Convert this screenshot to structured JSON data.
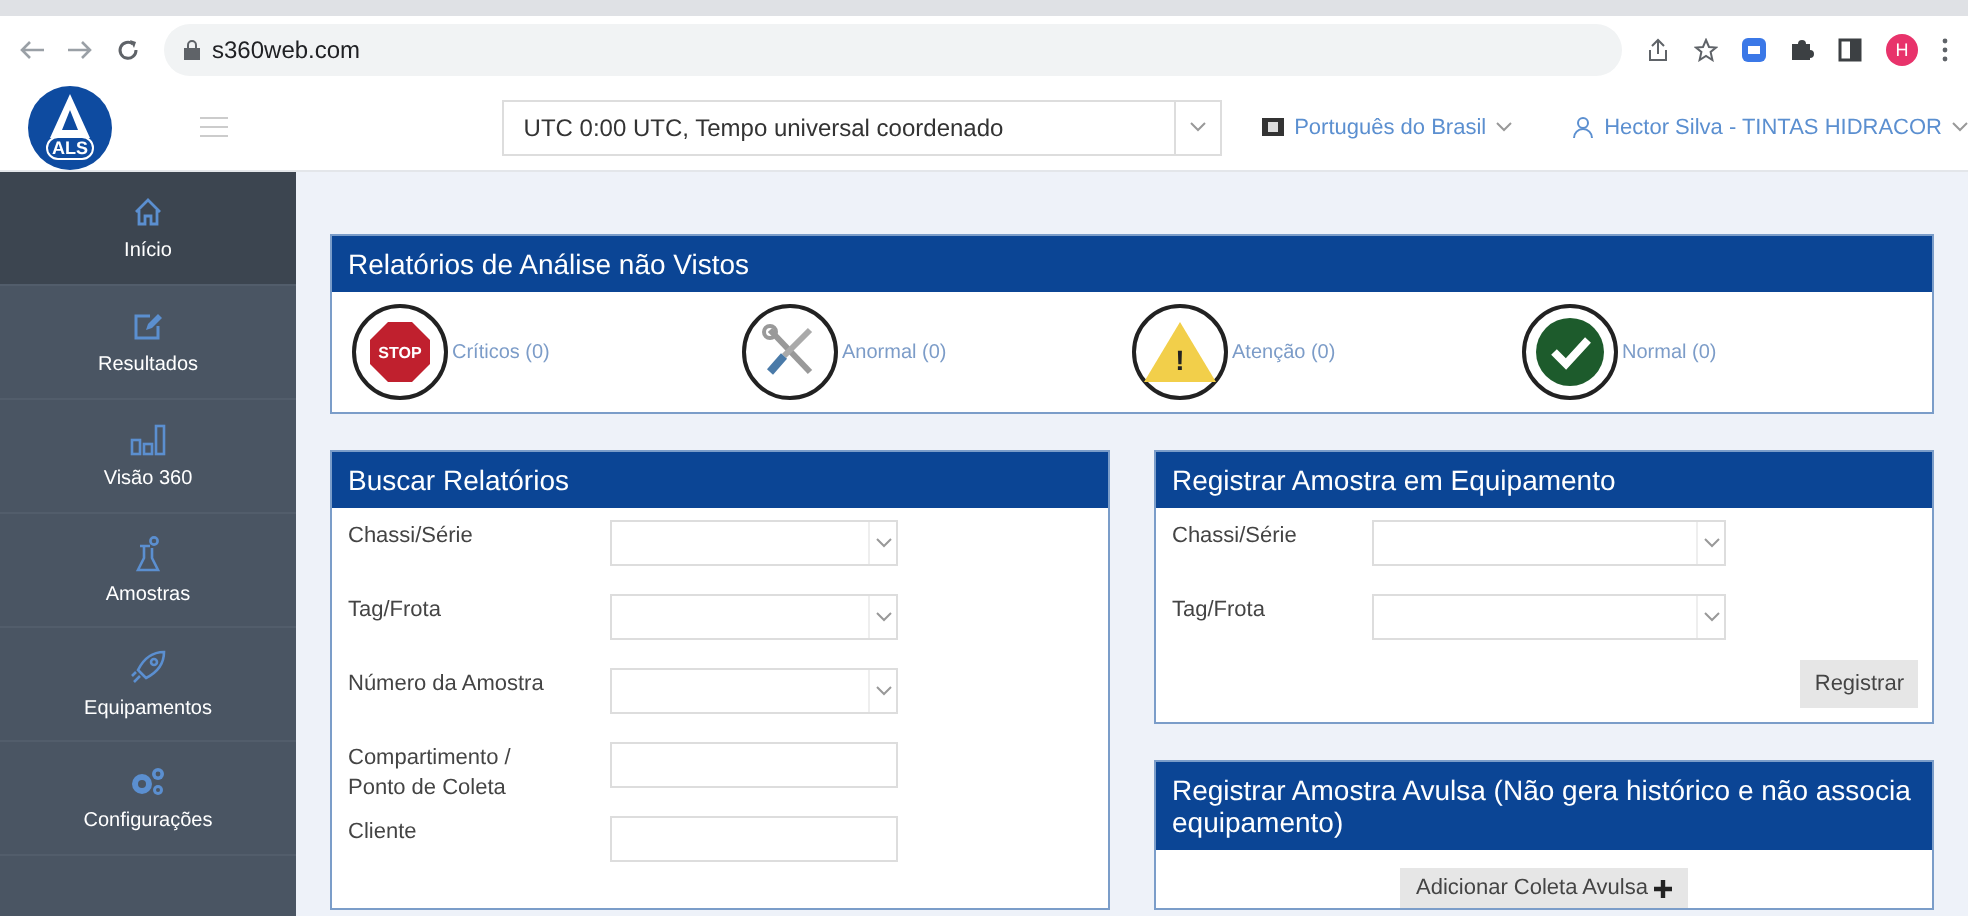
{
  "browser": {
    "address": "s360web.com",
    "profile_initial": "H"
  },
  "header": {
    "logo": "ALS",
    "timezone": "UTC 0:00 UTC, Tempo universal coordenado",
    "language": "Português do Brasil",
    "user": "Hector Silva - TINTAS HIDRACOR"
  },
  "sidebar": {
    "items": [
      {
        "label": "Início",
        "selected": true
      },
      {
        "label": "Resultados",
        "selected": false
      },
      {
        "label": "Visão 360",
        "selected": false
      },
      {
        "label": "Amostras",
        "selected": false
      },
      {
        "label": "Equipamentos",
        "selected": false
      },
      {
        "label": "Configurações",
        "selected": false
      }
    ]
  },
  "alerts": {
    "title": "Relatórios de Análise não Vistos",
    "items": [
      {
        "kind": "stop",
        "label": "Críticos (0)",
        "badge": "STOP"
      },
      {
        "kind": "tools",
        "label": "Anormal (0)"
      },
      {
        "kind": "warning",
        "label": "Atenção (0)",
        "badge": "!"
      },
      {
        "kind": "ok",
        "label": "Normal (0)"
      }
    ]
  },
  "search": {
    "title": "Buscar Relatórios",
    "fields": [
      {
        "label": "Chassi/Série",
        "kind": "select"
      },
      {
        "label": "Tag/Frota",
        "kind": "select"
      },
      {
        "label": "Número da Amostra",
        "kind": "select"
      },
      {
        "label": "Compartimento / Ponto de Coleta",
        "kind": "text"
      },
      {
        "label": "Cliente",
        "kind": "text"
      }
    ]
  },
  "register": {
    "title": "Registrar Amostra em Equipamento",
    "fields": [
      {
        "label": "Chassi/Série",
        "kind": "select"
      },
      {
        "label": "Tag/Frota",
        "kind": "select"
      }
    ],
    "button": "Registrar"
  },
  "loose": {
    "title": "Registrar Amostra Avulsa (Não gera histórico e não associa equipamento)",
    "button": "Adicionar Coleta Avulsa"
  }
}
